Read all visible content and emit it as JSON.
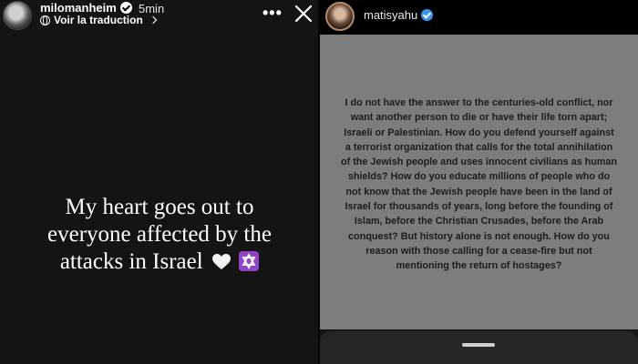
{
  "left_story": {
    "username": "milomanheim",
    "time": "5min",
    "translate_label": "Voir la traduction",
    "more_label": "•••",
    "story_lines": [
      "My heart goes out to",
      "everyone affected by the",
      "attacks in Israel"
    ],
    "emoji_names": [
      "white-heart-icon",
      "star-of-david-icon"
    ]
  },
  "right_story": {
    "username": "matisyahu",
    "text": "I do not have the answer to the centuries-old conflict, nor want another person to die or have their life torn apart; Israeli or Palestinian. How do you defend yourself against a terrorist organization that calls for the total annihilation of the Jewish people and uses innocent civilians as human shields? How do you educate millions of people who do not know that the Jewish people have been in the land of Israel for thousands of years, long before the founding of Islam, before the Christian Crusades, before the Arab conquest? But history alone is not enough. How do you reason with those calling for a cease-fire but not mentioning the return of hostages?",
    "card_color": "#7d7d7d"
  },
  "colors": {
    "verified_blue": "#3897f0",
    "emoji_purple": "#8e44c4"
  }
}
